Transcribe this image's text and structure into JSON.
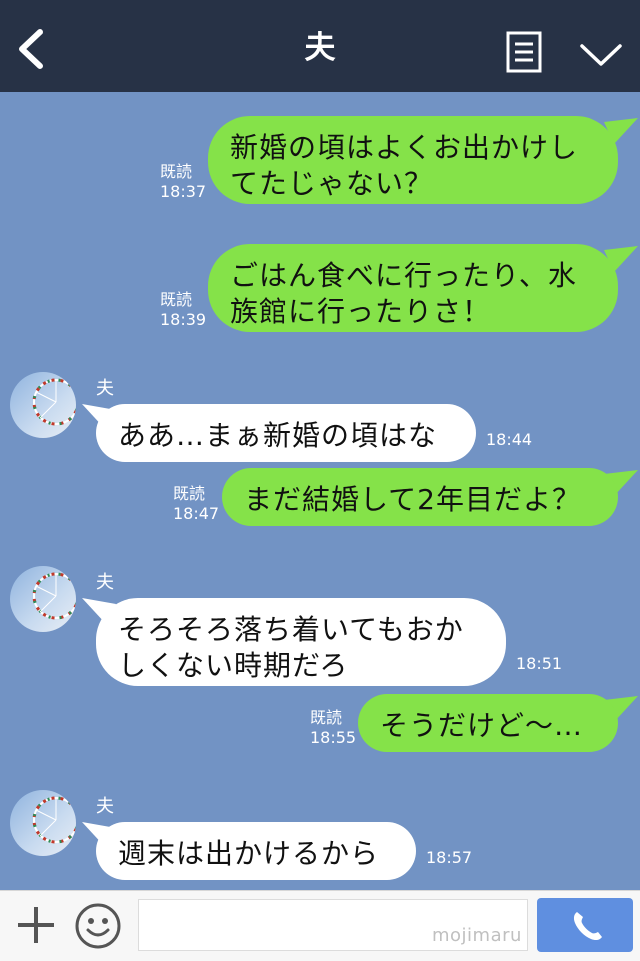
{
  "header": {
    "title": "夫"
  },
  "colors": {
    "header_bg": "#273246",
    "chat_bg": "#7293c4",
    "my_bubble": "#85e249",
    "their_bubble": "#ffffff",
    "call_button": "#5f8fe0"
  },
  "icons": {
    "back": "chevron-left-icon",
    "memo": "document-icon",
    "menu": "chevron-down-icon",
    "add": "plus-icon",
    "sticker": "smiley-icon",
    "call": "phone-icon"
  },
  "messages": [
    {
      "side": "me",
      "text": "新婚の頃はよくお出かけし\nてたじゃない？",
      "read": "既読",
      "time": "18:37"
    },
    {
      "side": "me",
      "text": "ごはん食べに行ったり、水\n族館に行ったりさ！",
      "read": "既読",
      "time": "18:39"
    },
    {
      "side": "them",
      "sender": "夫",
      "text": "ああ…まぁ新婚の頃はな",
      "time": "18:44"
    },
    {
      "side": "me",
      "text": "まだ結婚して2年目だよ？",
      "read": "既読",
      "time": "18:47"
    },
    {
      "side": "them",
      "sender": "夫",
      "text": "そろそろ落ち着いてもおか\nしくない時期だろ",
      "time": "18:51"
    },
    {
      "side": "me",
      "text": "そうだけど〜…",
      "read": "既読",
      "time": "18:55"
    },
    {
      "side": "them",
      "sender": "夫",
      "text": "週末は出かけるから",
      "time": "18:57"
    }
  ],
  "footer": {
    "input_placeholder": "",
    "watermark": "mojimaru"
  }
}
